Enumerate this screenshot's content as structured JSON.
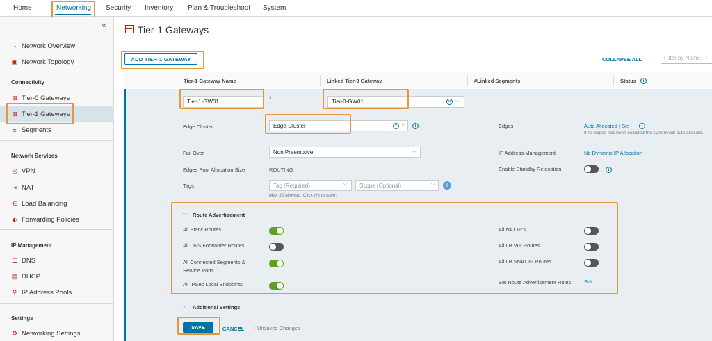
{
  "topnav": {
    "tabs": [
      {
        "label": "Home"
      },
      {
        "label": "Networking"
      },
      {
        "label": "Security"
      },
      {
        "label": "Inventory"
      },
      {
        "label": "Plan & Troubleshoot"
      },
      {
        "label": "System"
      }
    ],
    "active_color": "#0072a3"
  },
  "sidebar": {
    "collapse_icon": "double-chevron-left-icon",
    "top_items": [
      {
        "label": "Network Overview",
        "icon": "dashboard-icon"
      },
      {
        "label": "Network Topology",
        "icon": "topology-icon"
      }
    ],
    "connectivity": {
      "header": "Connectivity",
      "items": [
        {
          "label": "Tier-0 Gateways",
          "icon": "router-icon"
        },
        {
          "label": "Tier-1 Gateways",
          "icon": "router-icon"
        },
        {
          "label": "Segments",
          "icon": "segment-icon"
        }
      ]
    },
    "network_services": {
      "header": "Network Services",
      "items": [
        {
          "label": "VPN",
          "icon": "vpn-icon"
        },
        {
          "label": "NAT",
          "icon": "nat-icon"
        },
        {
          "label": "Load Balancing",
          "icon": "load-balancer-icon"
        },
        {
          "label": "Forwarding Policies",
          "icon": "forwarding-icon"
        }
      ]
    },
    "ip_management": {
      "header": "IP Management",
      "items": [
        {
          "label": "DNS",
          "icon": "dns-icon"
        },
        {
          "label": "DHCP",
          "icon": "dhcp-icon"
        },
        {
          "label": "IP Address Pools",
          "icon": "ip-pool-icon"
        }
      ]
    },
    "settings": {
      "header": "Settings",
      "items": [
        {
          "label": "Networking Settings",
          "icon": "settings-icon"
        }
      ]
    }
  },
  "main": {
    "title": "Tier-1 Gateways",
    "add_button": "ADD TIER-1 GATEWAY",
    "collapse_all": "COLLAPSE ALL",
    "filter_placeholder": "Filter by Name, P",
    "columns": [
      "Tier-1 Gateway Name",
      "Linked Tier-0 Gateway",
      "#Linked Segments",
      "Status"
    ],
    "form": {
      "name_value": "Tier-1-GW01",
      "required_mark": "*",
      "linked_t0_value": "Tier-0-GW01",
      "edge_cluster_label": "Edge Cluster",
      "edge_cluster_value": "Edge-Cluster",
      "edges_label": "Edges",
      "edges_value": "Auto Allocated | Set",
      "edges_help": "If no edges has been selected the system will auto allocate.",
      "failover_label": "Fail Over",
      "failover_value": "Non Preemptive",
      "ipam_label": "IP Address Management",
      "ipam_value": "No Dynamic IP Allocation",
      "edges_pool_label": "Edges Pool Allocation Size",
      "edges_pool_value": "ROUTING",
      "standby_label": "Enable Standby Relocation",
      "tags_label": "Tags",
      "tag_placeholder": "Tag (Required)",
      "scope_placeholder": "Scope (Optional)",
      "tags_help": "Max 30 allowed. Click (+) to save.",
      "route_adv_header": "Route Advertisement",
      "route_adv_left": [
        {
          "label": "All Static Routes",
          "on": true
        },
        {
          "label": "All DNS Forwarder Routes",
          "on": false
        },
        {
          "label": "All Connected Segments & Service Ports",
          "on": true
        },
        {
          "label": "All IPSec Local Endpoints",
          "on": true
        }
      ],
      "route_adv_right": [
        {
          "label": "All NAT IP's",
          "on": false
        },
        {
          "label": "All LB VIP Routes",
          "on": false
        },
        {
          "label": "All LB SNAT IP Routes",
          "on": false
        }
      ],
      "set_rules_label": "Set Route Advertisement Rules",
      "set_link": "Set",
      "additional_settings": "Additional Settings",
      "save": "SAVE",
      "cancel": "CANCEL",
      "unsaved": "Unsaved Changes"
    }
  },
  "colors": {
    "accent": "#0072a3",
    "highlight": "#e8963c",
    "toggle_on": "#5aa220",
    "toggle_off": "#565656",
    "icon_red": "#c21d00"
  }
}
